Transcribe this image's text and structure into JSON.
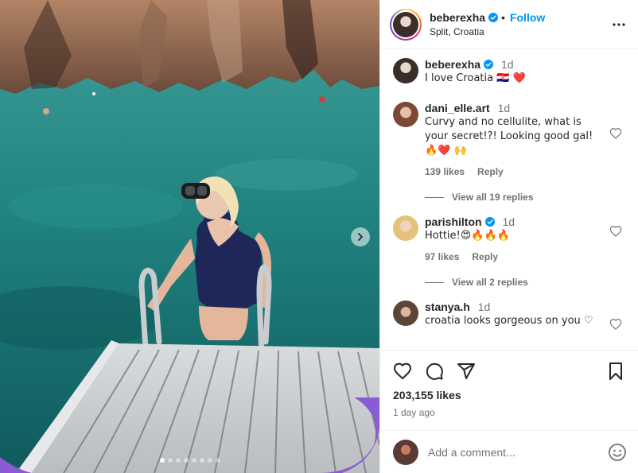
{
  "post": {
    "username": "beberexha",
    "follow_label": "Follow",
    "separator": "•",
    "location": "Split, Croatia",
    "carousel_slides": 8,
    "active_slide": 1
  },
  "comments": [
    {
      "username": "beberexha",
      "verified": true,
      "time": "1d",
      "text": "I love Croatia 🇭🇷 ❤️"
    },
    {
      "username": "dani_elle.art",
      "verified": false,
      "time": "1d",
      "text": "Curvy and no cellulite, what is your secret!?! Looking good gal! 🔥❤️ 🙌",
      "likes": "139 likes",
      "reply": "Reply",
      "view_replies": "View all 19 replies"
    },
    {
      "username": "parishilton",
      "verified": true,
      "time": "1d",
      "text": "Hottie!😍🔥🔥🔥",
      "likes": "97 likes",
      "reply": "Reply",
      "view_replies": "View all 2 replies"
    },
    {
      "username": "stanya.h",
      "verified": false,
      "time": "1d",
      "text": "croatia looks gorgeous on you ♡"
    }
  ],
  "stats": {
    "likes": "203,155 likes",
    "date": "1 day ago"
  },
  "composer": {
    "placeholder": "Add a comment..."
  },
  "colors": {
    "accent": "#0095f6",
    "text": "#262626",
    "muted": "#737373",
    "heart": "#ed4956"
  },
  "icons": [
    "heart-icon",
    "comment-icon",
    "share-icon",
    "bookmark-icon",
    "more-icon",
    "verified-icon",
    "chevron-right-icon",
    "emoji-icon"
  ]
}
